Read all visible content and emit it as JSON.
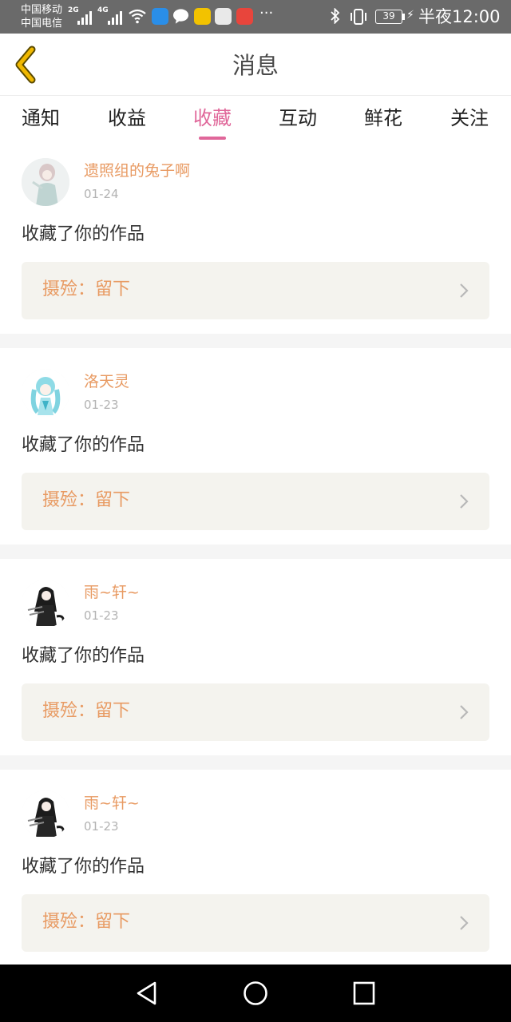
{
  "status_bar": {
    "carrier_1": "中国移动",
    "carrier_2": "中国电信",
    "net_1": "2G",
    "net_2": "4G",
    "more": "···",
    "battery": "39",
    "time": "半夜12:00"
  },
  "header": {
    "title": "消息"
  },
  "tabs": [
    {
      "label": "通知",
      "active": false
    },
    {
      "label": "收益",
      "active": false
    },
    {
      "label": "收藏",
      "active": true
    },
    {
      "label": "互动",
      "active": false
    },
    {
      "label": "鲜花",
      "active": false
    },
    {
      "label": "关注",
      "active": false
    }
  ],
  "messages": [
    {
      "user": "遗照组的兔子啊",
      "date": "01-24",
      "action": "收藏了你的作品",
      "work": "摄殓：留下"
    },
    {
      "user": "洛天灵",
      "date": "01-23",
      "action": "收藏了你的作品",
      "work": "摄殓：留下"
    },
    {
      "user": "雨~轩~",
      "date": "01-23",
      "action": "收藏了你的作品",
      "work": "摄殓：留下"
    },
    {
      "user": "雨~轩~",
      "date": "01-23",
      "action": "收藏了你的作品",
      "work": "摄殓：留下"
    }
  ],
  "colors": {
    "accent": "#e0679a",
    "username": "#e89a62",
    "work_box_bg": "#f4f3ee",
    "back_arrow": "#f0b800"
  },
  "icons": {
    "back": "back-arrow-icon",
    "chevron": "chevron-right-icon",
    "nav_back": "nav-back-icon",
    "nav_home": "nav-home-icon",
    "nav_recents": "nav-recents-icon"
  }
}
